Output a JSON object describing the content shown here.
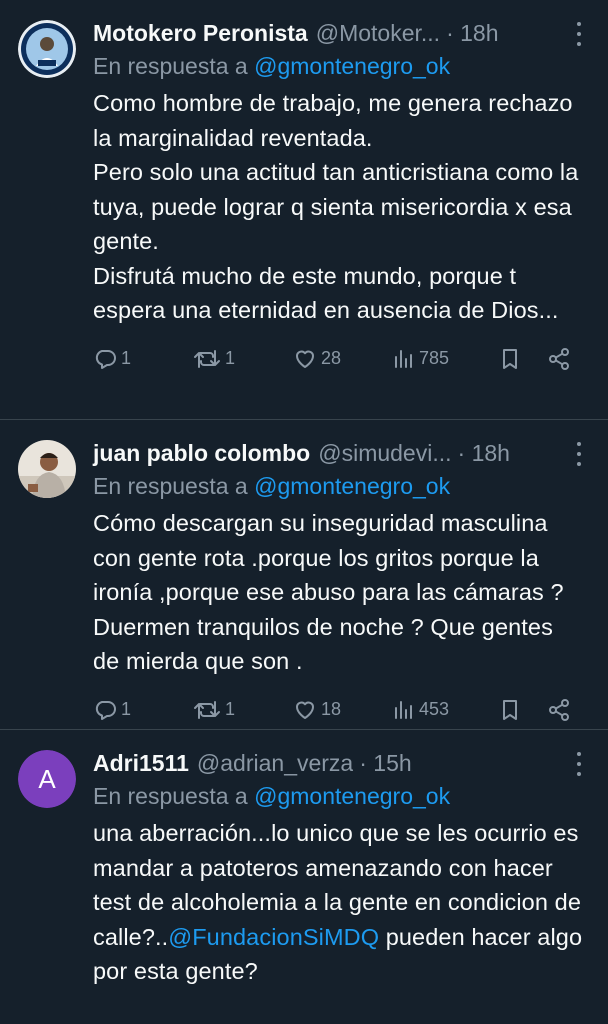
{
  "tweets": [
    {
      "name": "Motokero Peronista",
      "handle": "@Motoker...",
      "time": "· 18h",
      "reply_prefix": "En respuesta a ",
      "reply_to": "@gmontenegro_ok",
      "text": "Como hombre de trabajo, me genera rechazo la marginalidad reventada.\nPero solo una actitud tan anticristiana como la tuya, puede lograr q sienta misericordia x esa gente.\nDisfrutá mucho de este mundo, porque t espera una eternidad en ausencia de Dios...",
      "replies": "1",
      "retweets": "1",
      "likes": "28",
      "views": "785"
    },
    {
      "name": "juan pablo colombo",
      "handle": "@simudevi...",
      "time": "· 18h",
      "reply_prefix": "En respuesta a ",
      "reply_to": "@gmontenegro_ok",
      "text": "Cómo descargan su inseguridad masculina con gente rota .porque los gritos porque la ironía ,porque ese abuso para las cámaras ? Duermen tranquilos de noche ? Que gentes de mierda que son .",
      "replies": "1",
      "retweets": "1",
      "likes": "18",
      "views": "453"
    },
    {
      "name": "Adri1511",
      "handle": "@adrian_verza",
      "time": "· 15h",
      "avatar_letter": "A",
      "reply_prefix": "En respuesta a ",
      "reply_to": "@gmontenegro_ok",
      "text_before": "una aberración...lo unico que se les ocurrio es mandar a patoteros amenazando con hacer test de alcoholemia a la gente en condicion de calle?..",
      "text_mention": "@FundacionSiMDQ",
      "text_after": " pueden hacer algo por esta gente?"
    }
  ],
  "colors": {
    "background": "#15202b",
    "text": "#f7f9f9",
    "muted": "#8b98a5",
    "link": "#1d9bf0",
    "divider": "#38444d",
    "avatar_purple": "#7b3fbd"
  },
  "icons": [
    "more-icon",
    "reply-icon",
    "retweet-icon",
    "like-icon",
    "views-icon",
    "bookmark-icon",
    "share-icon"
  ]
}
